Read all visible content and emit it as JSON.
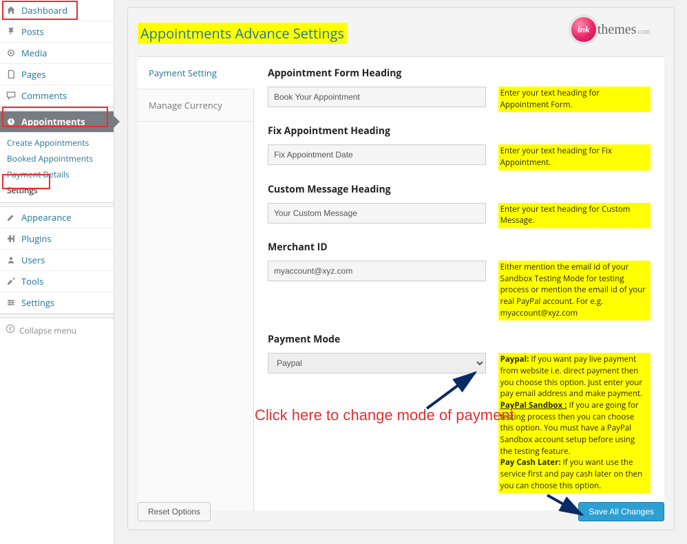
{
  "sidebar": {
    "items": [
      {
        "label": "Dashboard",
        "icon": "home"
      },
      {
        "label": "Posts",
        "icon": "pin"
      },
      {
        "label": "Media",
        "icon": "media"
      },
      {
        "label": "Pages",
        "icon": "page"
      },
      {
        "label": "Comments",
        "icon": "comment"
      },
      {
        "label": "Appointments",
        "icon": "appt",
        "current": true
      },
      {
        "label": "Appearance",
        "icon": "appearance"
      },
      {
        "label": "Plugins",
        "icon": "plugin"
      },
      {
        "label": "Users",
        "icon": "users"
      },
      {
        "label": "Tools",
        "icon": "tools"
      },
      {
        "label": "Settings",
        "icon": "settings"
      }
    ],
    "submenu": [
      {
        "label": "Create Appointments"
      },
      {
        "label": "Booked Appointments"
      },
      {
        "label": "Payment Details"
      },
      {
        "label": "Settings",
        "current": true
      }
    ],
    "collapse": "Collapse menu"
  },
  "logo": {
    "ink": "ink",
    "rest": "themes",
    "tld": ".com"
  },
  "page_title": "Appointments Advance Settings",
  "tabs": [
    {
      "label": "Payment Setting",
      "active": true
    },
    {
      "label": "Manage Currency"
    }
  ],
  "form": {
    "group1": {
      "heading": "Appointment Form Heading",
      "value": "Book Your Appointment",
      "help": "Enter your text heading for Appointment Form."
    },
    "group2": {
      "heading": "Fix Appointment Heading",
      "value": "Fix Appointment Date",
      "help": "Enter your text heading for Fix Appointment."
    },
    "group3": {
      "heading": "Custom Message Heading",
      "value": "Your Custom Message",
      "help": "Enter your text heading for Custom Message."
    },
    "group4": {
      "heading": "Merchant ID",
      "value": "myaccount@xyz.com",
      "help": "Either mention the email id of your Sandbox Testing Mode for testing process or mention the email id of your real PayPal account. For e.g. myaccount@xyz.com"
    },
    "group5": {
      "heading": "Payment Mode",
      "value": "Paypal",
      "help_paypal_label": "Paypal:",
      "help_paypal": " If you want pay live payment from website i.e. direct payment then you choose this option. Just enter your pay email address and make payment.",
      "help_sandbox_label": "PayPal Sandbox :",
      "help_sandbox": " If you are going for testing process then you can choose this option. You must have a PayPal Sandbox account setup before using the testing feature.",
      "help_cash_label": "Pay Cash Later:",
      "help_cash": " If you want use the service first and pay cash later on then you can choose this option."
    }
  },
  "callout": "Click here to change mode of payment",
  "buttons": {
    "reset": "Reset Options",
    "save": "Save All Changes"
  }
}
